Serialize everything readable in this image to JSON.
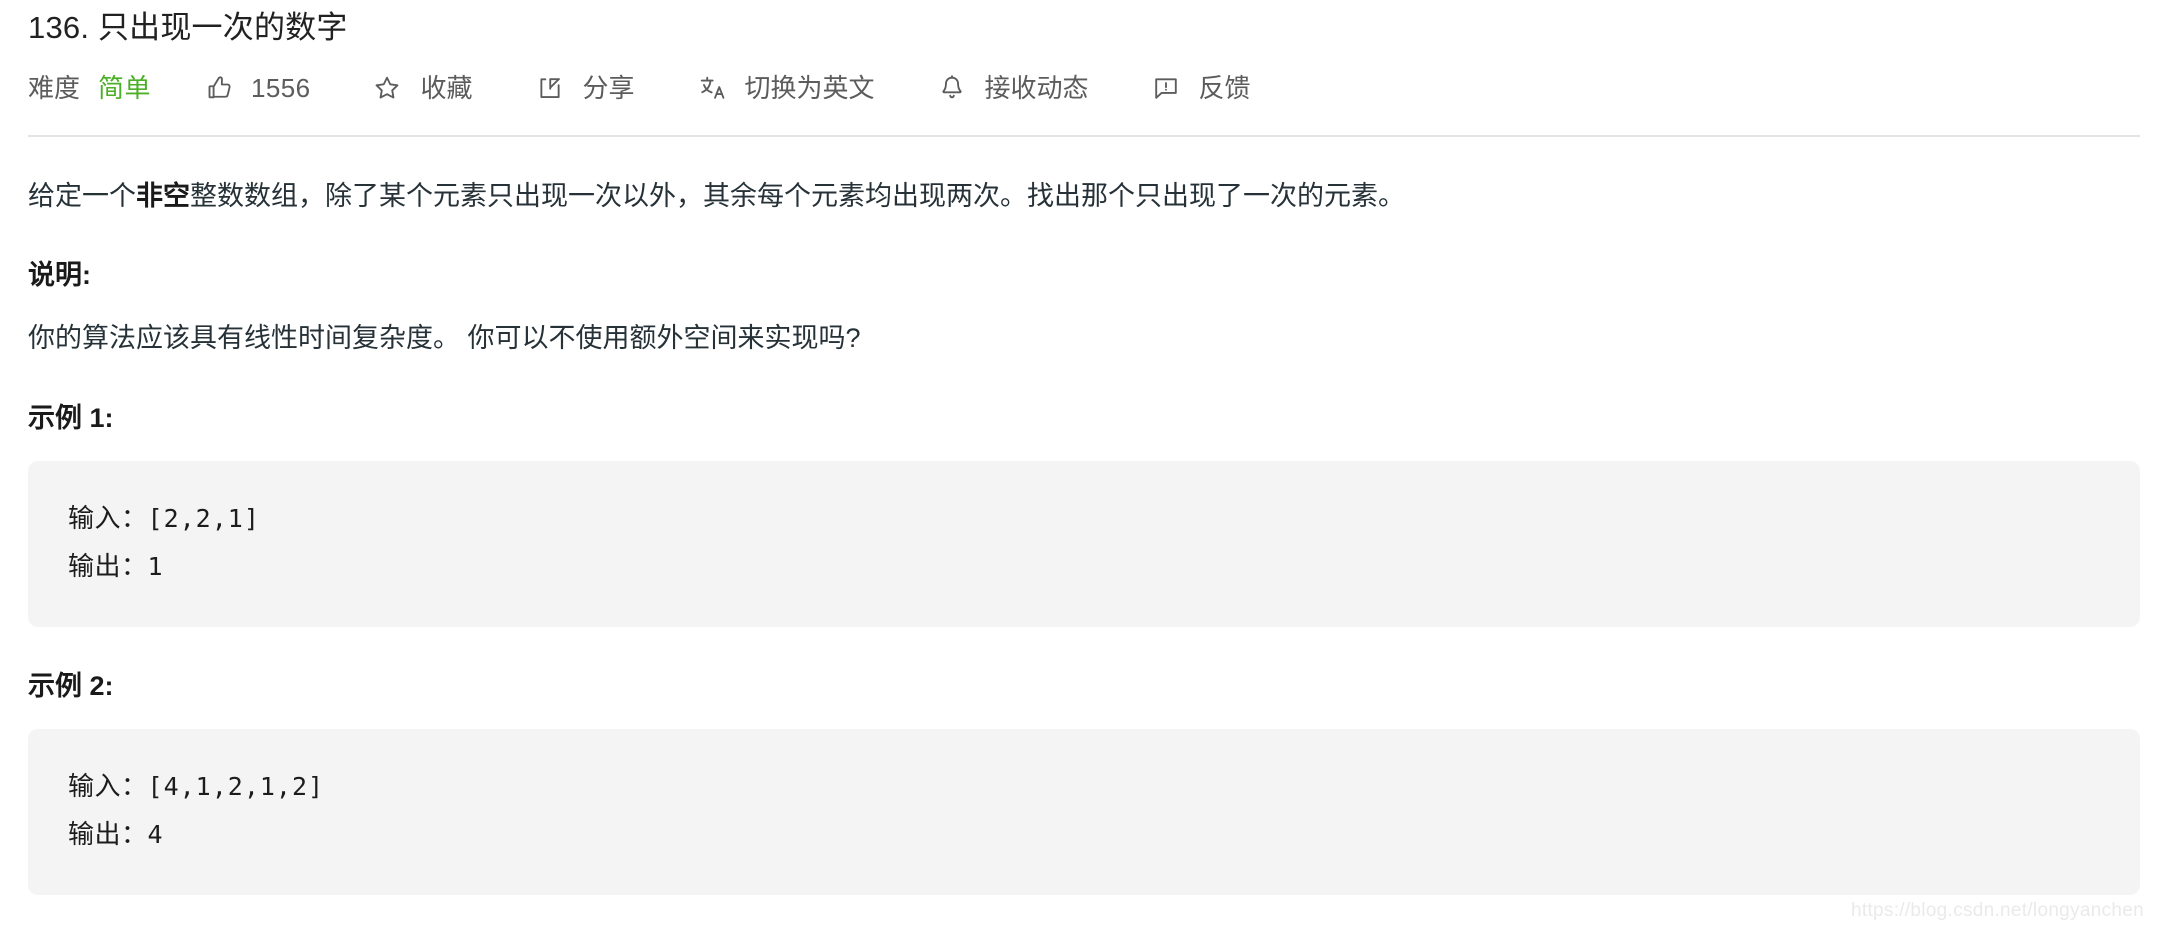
{
  "problem": {
    "title": "136. 只出现一次的数字"
  },
  "toolbar": {
    "difficulty_label": "难度",
    "difficulty_value": "简单",
    "difficulty_color": "#4caf28",
    "items": [
      {
        "icon": "thumbs-up-icon",
        "label": "1556"
      },
      {
        "icon": "star-icon",
        "label": "收藏"
      },
      {
        "icon": "share-icon",
        "label": "分享"
      },
      {
        "icon": "translate-icon",
        "label": "切换为英文"
      },
      {
        "icon": "bell-icon",
        "label": "接收动态"
      },
      {
        "icon": "feedback-icon",
        "label": "反馈"
      }
    ]
  },
  "description": {
    "part1": "给定一个",
    "bold": "非空",
    "part2": "整数数组，除了某个元素只出现一次以外，其余每个元素均出现两次。找出那个只出现了一次的元素。"
  },
  "notes": {
    "heading": "说明:",
    "text": "你的算法应该具有线性时间复杂度。 你可以不使用额外空间来实现吗?"
  },
  "examples": [
    {
      "heading": "示例 1:",
      "input_label": "输入：",
      "input_value": "[2,2,1]",
      "output_label": "输出：",
      "output_value": "1"
    },
    {
      "heading": "示例 2:",
      "input_label": "输入：",
      "input_value": "[4,1,2,1,2]",
      "output_label": "输出：",
      "output_value": "4"
    }
  ],
  "watermark": "https://blog.csdn.net/longyanchen"
}
